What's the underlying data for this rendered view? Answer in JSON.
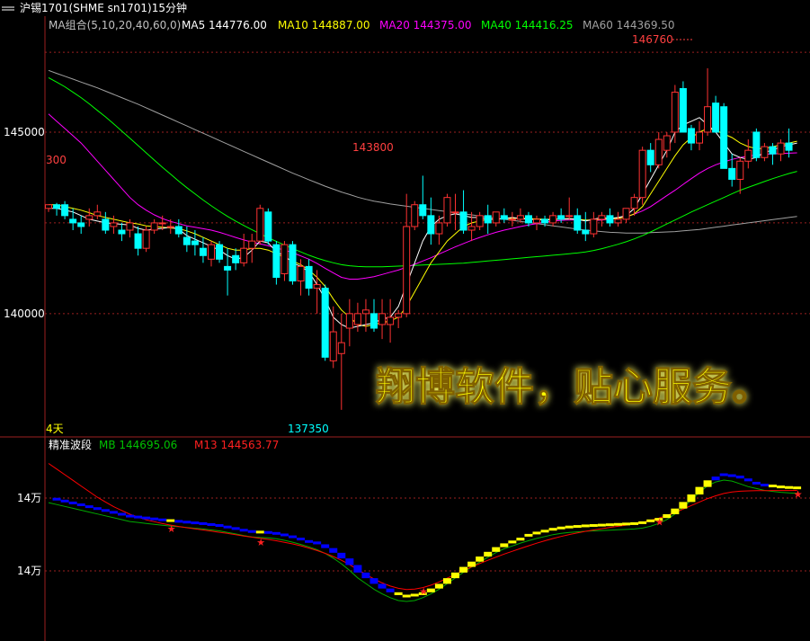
{
  "header": {
    "title": "沪锡1701(SHME  sn1701)15分钟"
  },
  "main_legend": [
    {
      "label": "MA组合(5,10,20,40,60,0)",
      "color": "#c0c0c0"
    },
    {
      "label": "MA5  144776.00",
      "color": "#ffffff"
    },
    {
      "label": "MA10  144887.00",
      "color": "#ffff00"
    },
    {
      "label": "MA20  144375.00",
      "color": "#ff00ff"
    },
    {
      "label": "MA40  144416.25",
      "color": "#00ff00"
    },
    {
      "label": "MA60  144369.50",
      "color": "#a0a0a0"
    }
  ],
  "watermark": "翔博软件，贴心服务。",
  "period_label": "4天",
  "sub_legend": {
    "name": "精准波段",
    "mb": "MB  144695.06",
    "m13": "M13  144563.77"
  },
  "sub_axis_labels": [
    "14万",
    "14万"
  ],
  "colors": {
    "up": "#ff3232",
    "down": "#00ffff",
    "ma5": "#ffffff",
    "ma10": "#ffff00",
    "ma20": "#ff00ff",
    "ma40": "#00ff00",
    "ma60": "#a0a0a0",
    "grid": "#9b1f1f",
    "band_up": "#ffff00",
    "band_down": "#0000ff",
    "m13": "#ff0000",
    "mb": "#00aa00"
  },
  "chart_data": {
    "type": "candlestick",
    "ylim": [
      137000,
      147600
    ],
    "y_ticks": [
      140000,
      145000
    ],
    "price_labels": [
      {
        "text": "146760",
        "value": 146760
      },
      {
        "text": "143800",
        "value": 143800
      },
      {
        "text": "137350",
        "value": 137350
      },
      {
        "text": "300",
        "value": 143700
      }
    ],
    "candles": [
      [
        142900,
        143000,
        142800,
        143000
      ],
      [
        143000,
        143050,
        142700,
        142900
      ],
      [
        143000,
        143100,
        142600,
        142700
      ],
      [
        142600,
        142900,
        142300,
        142500
      ],
      [
        142500,
        142700,
        142200,
        142400
      ],
      [
        142600,
        142900,
        142400,
        142700
      ],
      [
        142700,
        143000,
        142600,
        142800
      ],
      [
        142600,
        142800,
        142200,
        142300
      ],
      [
        142400,
        142700,
        142200,
        142500
      ],
      [
        142300,
        142500,
        142000,
        142200
      ],
      [
        142300,
        142600,
        142100,
        142500
      ],
      [
        142200,
        142400,
        141600,
        141800
      ],
      [
        141800,
        142400,
        141700,
        142300
      ],
      [
        142300,
        142600,
        142200,
        142500
      ],
      [
        142500,
        142700,
        142300,
        142500
      ],
      [
        142400,
        142600,
        142200,
        142400
      ],
      [
        142400,
        142600,
        142100,
        142200
      ],
      [
        142100,
        142400,
        141700,
        141900
      ],
      [
        142000,
        142300,
        141600,
        141900
      ],
      [
        141800,
        142100,
        141400,
        141600
      ],
      [
        141500,
        142000,
        141300,
        141900
      ],
      [
        141900,
        142000,
        141400,
        141500
      ],
      [
        141300,
        141800,
        140500,
        141200
      ],
      [
        141600,
        141800,
        141200,
        141400
      ],
      [
        141400,
        142200,
        141300,
        141800
      ],
      [
        141800,
        142200,
        141400,
        142000
      ],
      [
        142000,
        143000,
        141900,
        142900
      ],
      [
        142800,
        142900,
        141900,
        142000
      ],
      [
        141900,
        142000,
        140800,
        141000
      ],
      [
        141100,
        142000,
        140900,
        141900
      ],
      [
        141900,
        142000,
        140800,
        140900
      ],
      [
        140900,
        141500,
        140500,
        141300
      ],
      [
        141300,
        141500,
        140500,
        140700
      ],
      [
        140700,
        141200,
        140000,
        140800
      ],
      [
        140700,
        140800,
        138700,
        138800
      ],
      [
        138700,
        140200,
        138500,
        139500
      ],
      [
        138900,
        140000,
        137350,
        139200
      ],
      [
        139600,
        140400,
        139100,
        140000
      ],
      [
        139700,
        140300,
        139500,
        140000
      ],
      [
        140000,
        140400,
        139500,
        140100
      ],
      [
        140000,
        140400,
        139500,
        139600
      ],
      [
        139700,
        140400,
        139300,
        140000
      ],
      [
        139700,
        140400,
        139200,
        139900
      ],
      [
        139900,
        140100,
        139600,
        140000
      ],
      [
        140000,
        143300,
        139900,
        142400
      ],
      [
        142400,
        143100,
        142300,
        143000
      ],
      [
        143000,
        143800,
        142600,
        142700
      ],
      [
        142700,
        143200,
        141900,
        142200
      ],
      [
        142200,
        142700,
        141900,
        142500
      ],
      [
        142500,
        143300,
        142400,
        143200
      ],
      [
        142800,
        143300,
        142300,
        142800
      ],
      [
        142800,
        143400,
        142200,
        142300
      ],
      [
        142300,
        142800,
        142000,
        142400
      ],
      [
        142400,
        142800,
        142300,
        142700
      ],
      [
        142700,
        143000,
        142200,
        142500
      ],
      [
        142500,
        142800,
        142400,
        142800
      ],
      [
        142700,
        142900,
        142500,
        142600
      ],
      [
        142600,
        142800,
        142400,
        142600
      ],
      [
        142600,
        142900,
        142500,
        142700
      ],
      [
        142700,
        142800,
        142400,
        142500
      ],
      [
        142500,
        142700,
        142300,
        142600
      ],
      [
        142600,
        142700,
        142400,
        142500
      ],
      [
        142500,
        142800,
        142400,
        142700
      ],
      [
        142700,
        142900,
        142500,
        142600
      ],
      [
        142700,
        143200,
        142600,
        142700
      ],
      [
        142700,
        142900,
        142200,
        142300
      ],
      [
        142300,
        142800,
        142000,
        142200
      ],
      [
        142200,
        142800,
        142100,
        142600
      ],
      [
        142600,
        142800,
        142400,
        142700
      ],
      [
        142700,
        142900,
        142400,
        142500
      ],
      [
        142500,
        142800,
        142400,
        142600
      ],
      [
        142600,
        142900,
        142500,
        142900
      ],
      [
        142900,
        143300,
        142700,
        143200
      ],
      [
        143200,
        144600,
        143000,
        144500
      ],
      [
        144500,
        144700,
        143900,
        144100
      ],
      [
        144100,
        145000,
        144000,
        144800
      ],
      [
        144500,
        145000,
        144300,
        144900
      ],
      [
        145000,
        146300,
        144700,
        146100
      ],
      [
        146200,
        146400,
        145000,
        145000
      ],
      [
        145100,
        145200,
        144500,
        144700
      ],
      [
        144700,
        145300,
        144500,
        145000
      ],
      [
        145000,
        146760,
        144900,
        145700
      ],
      [
        145800,
        146000,
        145000,
        145000
      ],
      [
        145700,
        145800,
        144000,
        144000
      ],
      [
        144000,
        144400,
        143500,
        143700
      ],
      [
        143700,
        144300,
        143300,
        144200
      ],
      [
        144200,
        144800,
        144000,
        144500
      ],
      [
        145000,
        145100,
        144200,
        144300
      ],
      [
        144300,
        144700,
        144200,
        144600
      ],
      [
        144600,
        144700,
        144100,
        144400
      ],
      [
        144400,
        144800,
        144200,
        144700
      ],
      [
        144700,
        145100,
        144300,
        144500
      ]
    ],
    "ma5": [
      142900,
      142900,
      142850,
      142800,
      142700,
      142600,
      142550,
      142500,
      142480,
      142460,
      142440,
      142350,
      142300,
      142330,
      142350,
      142380,
      142330,
      142150,
      142050,
      141950,
      141850,
      141750,
      141600,
      141500,
      141550,
      141750,
      142000,
      141950,
      141700,
      141600,
      141400,
      141300,
      141150,
      140800,
      140400,
      139900,
      139700,
      139600,
      139650,
      139700,
      139750,
      139850,
      139900,
      140200,
      140800,
      141400,
      142000,
      142400,
      142600,
      142700,
      142750,
      142700,
      142650,
      142650,
      142600,
      142600,
      142620,
      142650,
      142620,
      142600,
      142590,
      142580,
      142590,
      142610,
      142620,
      142600,
      142550,
      142600,
      142650,
      142620,
      142650,
      142700,
      142900,
      143300,
      143700,
      144100,
      144500,
      145000,
      145200,
      145300,
      145400,
      145200,
      145000,
      144700,
      144400,
      144300,
      144250,
      144300,
      144450,
      144500,
      144600,
      144650,
      144700
    ],
    "ma10": [
      143000,
      143000,
      142950,
      142900,
      142850,
      142780,
      142700,
      142650,
      142600,
      142550,
      142500,
      142470,
      142420,
      142400,
      142380,
      142360,
      142340,
      142280,
      142200,
      142100,
      142000,
      141900,
      141800,
      141750,
      141750,
      141800,
      141800,
      141750,
      141650,
      141550,
      141450,
      141350,
      141200,
      141000,
      140750,
      140400,
      140100,
      139900,
      139700,
      139650,
      139700,
      139750,
      139800,
      139900,
      140200,
      140600,
      141000,
      141400,
      141700,
      142000,
      142200,
      142400,
      142500,
      142550,
      142600,
      142600,
      142620,
      142630,
      142630,
      142620,
      142610,
      142600,
      142600,
      142600,
      142610,
      142600,
      142580,
      142580,
      142600,
      142610,
      142630,
      142660,
      142750,
      142950,
      143300,
      143650,
      144000,
      144350,
      144650,
      144850,
      145000,
      145100,
      145050,
      144950,
      144850,
      144700,
      144600,
      144550,
      144550,
      144600,
      144650,
      144700,
      144750
    ],
    "ma20": [
      145500,
      145300,
      145100,
      144900,
      144700,
      144450,
      144200,
      143950,
      143700,
      143450,
      143200,
      143000,
      142850,
      142720,
      142620,
      142540,
      142480,
      142420,
      142380,
      142340,
      142300,
      142240,
      142170,
      142100,
      142030,
      141970,
      141920,
      141870,
      141810,
      141750,
      141680,
      141590,
      141500,
      141380,
      141250,
      141120,
      141000,
      140950,
      140950,
      140980,
      141020,
      141080,
      141140,
      141200,
      141280,
      141360,
      141450,
      141540,
      141640,
      141740,
      141840,
      141930,
      142020,
      142100,
      142170,
      142240,
      142300,
      142350,
      142400,
      142440,
      142480,
      142520,
      142550,
      142570,
      142580,
      142580,
      142570,
      142570,
      142580,
      142600,
      142630,
      142670,
      142740,
      142830,
      142950,
      143100,
      143250,
      143400,
      143560,
      143720,
      143870,
      144000,
      144100,
      144180,
      144250,
      144300,
      144340,
      144370,
      144390,
      144400,
      144410,
      144420,
      144430
    ],
    "ma40": [
      146500,
      146380,
      146250,
      146100,
      145950,
      145780,
      145600,
      145420,
      145230,
      145030,
      144830,
      144630,
      144430,
      144230,
      144030,
      143840,
      143650,
      143470,
      143300,
      143130,
      142970,
      142820,
      142680,
      142550,
      142430,
      142310,
      142200,
      142090,
      141990,
      141890,
      141790,
      141700,
      141610,
      141530,
      141460,
      141400,
      141350,
      141320,
      141300,
      141290,
      141290,
      141290,
      141300,
      141310,
      141320,
      141330,
      141340,
      141350,
      141360,
      141370,
      141380,
      141390,
      141410,
      141430,
      141450,
      141470,
      141490,
      141510,
      141530,
      141550,
      141570,
      141590,
      141610,
      141630,
      141650,
      141670,
      141700,
      141740,
      141790,
      141850,
      141910,
      141980,
      142060,
      142150,
      142250,
      142360,
      142470,
      142580,
      142690,
      142800,
      142900,
      143000,
      143100,
      143200,
      143300,
      143400,
      143480,
      143560,
      143640,
      143720,
      143790,
      143860,
      143920
    ],
    "ma60": [
      146700,
      146620,
      146540,
      146460,
      146380,
      146300,
      146220,
      146130,
      146040,
      145950,
      145860,
      145770,
      145670,
      145570,
      145470,
      145370,
      145270,
      145170,
      145070,
      144970,
      144870,
      144770,
      144670,
      144570,
      144470,
      144370,
      144270,
      144170,
      144070,
      143970,
      143870,
      143780,
      143690,
      143600,
      143510,
      143430,
      143350,
      143280,
      143210,
      143150,
      143100,
      143060,
      143020,
      142990,
      142960,
      142930,
      142900,
      142870,
      142840,
      142810,
      142780,
      142750,
      142720,
      142690,
      142660,
      142630,
      142600,
      142570,
      142540,
      142510,
      142480,
      142450,
      142420,
      142390,
      142360,
      142330,
      142300,
      142280,
      142260,
      142240,
      142230,
      142220,
      142220,
      142220,
      142230,
      142240,
      142250,
      142260,
      142280,
      142300,
      142320,
      142350,
      142380,
      142410,
      142440,
      142470,
      142500,
      142530,
      142560,
      142590,
      142620,
      142650,
      142680
    ],
    "band": {
      "ylim": [
        136800,
        146500
      ],
      "mb": [
        144200,
        144100,
        144000,
        143900,
        143800,
        143700,
        143600,
        143500,
        143400,
        143300,
        143200,
        143150,
        143100,
        143050,
        143000,
        142960,
        142920,
        142880,
        142840,
        142800,
        142750,
        142700,
        142620,
        142540,
        142450,
        142380,
        142350,
        142330,
        142280,
        142200,
        142100,
        141980,
        141850,
        141700,
        141500,
        141250,
        140950,
        140600,
        140200,
        139900,
        139600,
        139350,
        139150,
        139000,
        138950,
        139000,
        139150,
        139350,
        139600,
        139900,
        140200,
        140500,
        140780,
        141050,
        141300,
        141550,
        141750,
        141900,
        142050,
        142180,
        142300,
        142400,
        142500,
        142570,
        142620,
        142650,
        142680,
        142700,
        142720,
        142740,
        142760,
        142780,
        142800,
        142850,
        142950,
        143100,
        143300,
        143600,
        143950,
        144350,
        144750,
        145100,
        145300,
        145400,
        145350,
        145200,
        145050,
        144950,
        144850,
        144800,
        144750,
        144720,
        144700
      ],
      "m13": [
        146000,
        145700,
        145400,
        145100,
        144800,
        144500,
        144200,
        143950,
        143700,
        143500,
        143300,
        143150,
        143000,
        142900,
        142800,
        142720,
        142650,
        142580,
        142520,
        142460,
        142400,
        142340,
        142280,
        142210,
        142140,
        142080,
        142020,
        141960,
        141890,
        141810,
        141720,
        141620,
        141500,
        141370,
        141220,
        141050,
        140850,
        140620,
        140360,
        140100,
        139860,
        139650,
        139480,
        139360,
        139300,
        139320,
        139400,
        139530,
        139700,
        139900,
        140100,
        140300,
        140500,
        140680,
        140850,
        141020,
        141180,
        141330,
        141480,
        141620,
        141760,
        141890,
        142010,
        142120,
        142220,
        142310,
        142390,
        142460,
        142530,
        142600,
        142660,
        142720,
        142790,
        142870,
        142970,
        143090,
        143230,
        143390,
        143570,
        143760,
        143950,
        144130,
        144280,
        144400,
        144480,
        144520,
        144540,
        144550,
        144555,
        144558,
        144560,
        144562,
        144564
      ],
      "blocks_dir": [
        "d",
        "d",
        "d",
        "d",
        "d",
        "d",
        "d",
        "d",
        "d",
        "d",
        "d",
        "d",
        "d",
        "d",
        "d",
        "u",
        "d",
        "d",
        "d",
        "d",
        "d",
        "d",
        "d",
        "d",
        "d",
        "d",
        "u",
        "d",
        "d",
        "d",
        "d",
        "d",
        "d",
        "d",
        "d",
        "d",
        "d",
        "d",
        "d",
        "d",
        "d",
        "d",
        "d",
        "u",
        "u",
        "u",
        "u",
        "u",
        "u",
        "u",
        "u",
        "u",
        "u",
        "u",
        "u",
        "u",
        "u",
        "u",
        "u",
        "u",
        "u",
        "u",
        "u",
        "u",
        "u",
        "u",
        "u",
        "u",
        "u",
        "u",
        "u",
        "u",
        "u",
        "u",
        "u",
        "u",
        "u",
        "u",
        "u",
        "u",
        "u",
        "u",
        "d",
        "d",
        "d",
        "d",
        "d",
        "d",
        "d",
        "u",
        "u",
        "u",
        "u"
      ],
      "stars": [
        15,
        26,
        46,
        75,
        96,
        101
      ]
    }
  }
}
